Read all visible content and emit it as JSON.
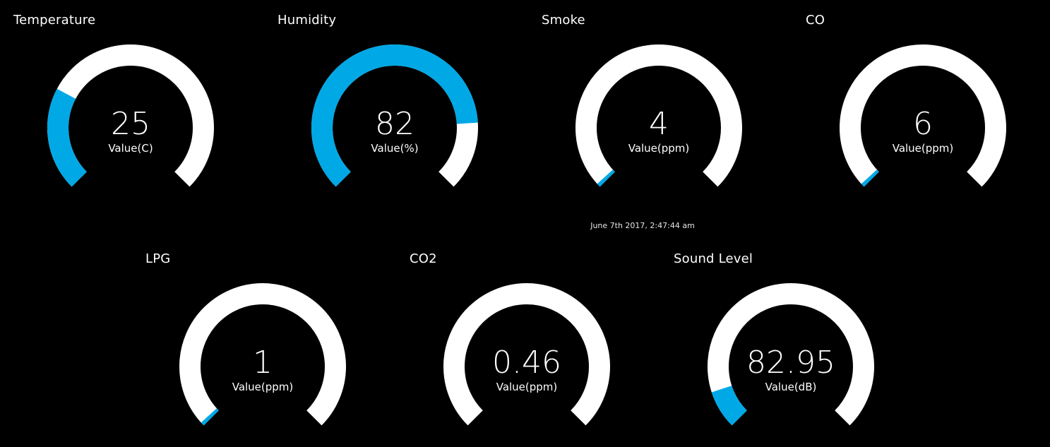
{
  "colors": {
    "background": "#000000",
    "track": "#ffffff",
    "fill": "#00a8e6",
    "text": "#ffffff"
  },
  "timestamp": "June 7th 2017, 2:47:44 am",
  "gauges": [
    {
      "title": "Temperature",
      "value": "25",
      "unit": "Value(C)",
      "fraction": 0.27
    },
    {
      "title": "Humidity",
      "value": "82",
      "unit": "Value(%)",
      "fraction": 0.82
    },
    {
      "title": "Smoke",
      "value": "4",
      "unit": "Value(ppm)",
      "fraction": 0.01
    },
    {
      "title": "CO",
      "value": "6",
      "unit": "Value(ppm)",
      "fraction": 0.01
    },
    {
      "title": "LPG",
      "value": "1",
      "unit": "Value(ppm)",
      "fraction": 0.01
    },
    {
      "title": "CO2",
      "value": "0.46",
      "unit": "Value(ppm)",
      "fraction": 0.0
    },
    {
      "title": "Sound Level",
      "value": "82.95",
      "unit": "Value(dB)",
      "fraction": 0.1
    }
  ]
}
